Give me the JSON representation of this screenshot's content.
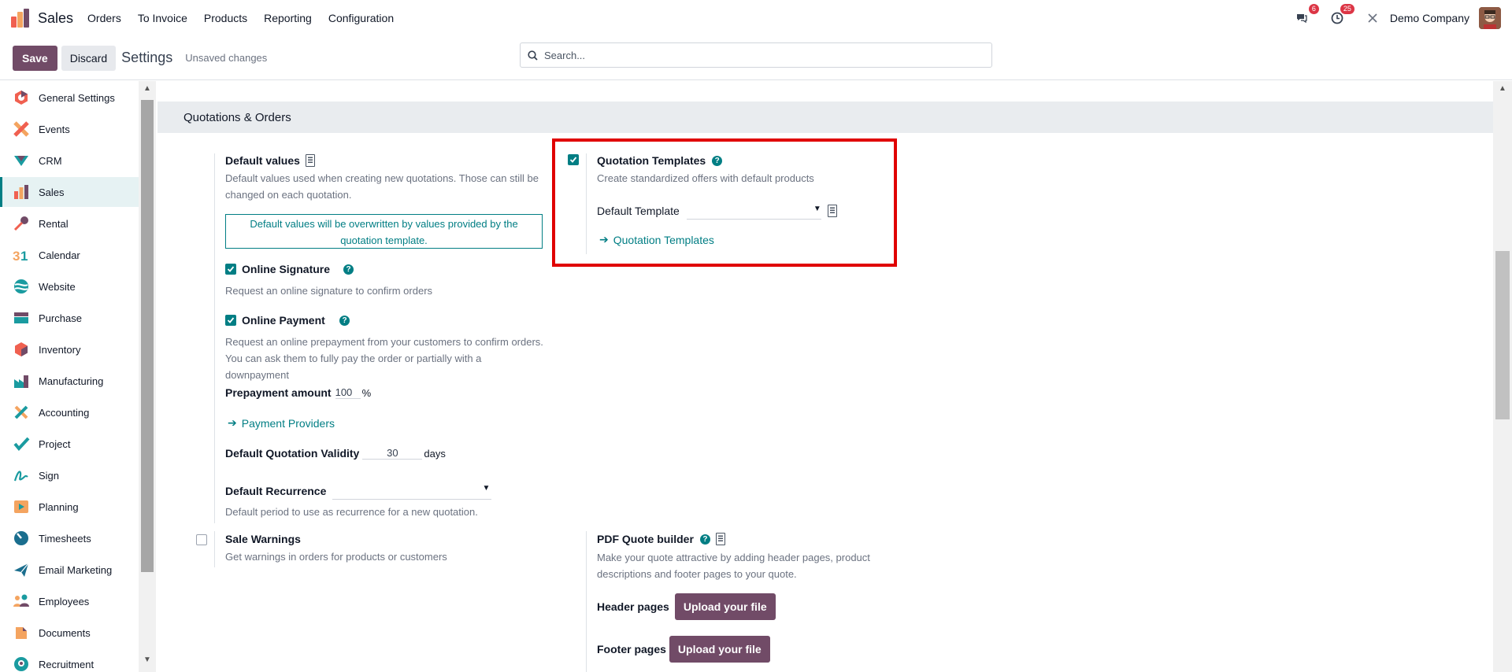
{
  "navbar": {
    "app_title": "Sales",
    "menu": [
      "Orders",
      "To Invoice",
      "Products",
      "Reporting",
      "Configuration"
    ],
    "messages_count": "6",
    "activities_count": "25",
    "company": "Demo Company"
  },
  "control": {
    "save_label": "Save",
    "discard_label": "Discard",
    "title": "Settings",
    "status": "Unsaved changes",
    "search_placeholder": "Search..."
  },
  "sidebar": {
    "items": [
      {
        "label": "General Settings",
        "icon": "general-settings-icon"
      },
      {
        "label": "Events",
        "icon": "events-icon"
      },
      {
        "label": "CRM",
        "icon": "crm-icon"
      },
      {
        "label": "Sales",
        "icon": "sales-icon",
        "active": true
      },
      {
        "label": "Rental",
        "icon": "rental-icon"
      },
      {
        "label": "Calendar",
        "icon": "calendar-icon"
      },
      {
        "label": "Website",
        "icon": "website-icon"
      },
      {
        "label": "Purchase",
        "icon": "purchase-icon"
      },
      {
        "label": "Inventory",
        "icon": "inventory-icon"
      },
      {
        "label": "Manufacturing",
        "icon": "manufacturing-icon"
      },
      {
        "label": "Accounting",
        "icon": "accounting-icon"
      },
      {
        "label": "Project",
        "icon": "project-icon"
      },
      {
        "label": "Sign",
        "icon": "sign-icon"
      },
      {
        "label": "Planning",
        "icon": "planning-icon"
      },
      {
        "label": "Timesheets",
        "icon": "timesheets-icon"
      },
      {
        "label": "Email Marketing",
        "icon": "email-marketing-icon"
      },
      {
        "label": "Employees",
        "icon": "employees-icon"
      },
      {
        "label": "Documents",
        "icon": "documents-icon"
      },
      {
        "label": "Recruitment",
        "icon": "recruitment-icon"
      }
    ]
  },
  "section": {
    "title": "Quotations & Orders"
  },
  "default_values": {
    "label": "Default values",
    "description": "Default values used when creating new quotations. Those can still be changed on each quotation.",
    "notice": "Default values will be overwritten by values provided by the quotation template."
  },
  "online_signature": {
    "label": "Online Signature",
    "checked": true,
    "description": "Request an online signature to confirm orders"
  },
  "online_payment": {
    "label": "Online Payment",
    "checked": true,
    "description": "Request an online prepayment from your customers to confirm orders. You can ask them to fully pay the order or partially with a downpayment",
    "prepayment_label": "Prepayment amount",
    "prepayment_value": "100",
    "prepayment_unit": "%",
    "link": "Payment Providers"
  },
  "validity": {
    "label": "Default Quotation Validity",
    "value": "30",
    "unit": "days"
  },
  "recurrence": {
    "label": "Default Recurrence",
    "value": "",
    "description": "Default period to use as recurrence for a new quotation."
  },
  "quotation_templates": {
    "label": "Quotation Templates",
    "checked": true,
    "description": "Create standardized offers with default products",
    "template_label": "Default Template",
    "template_value": "",
    "link": "Quotation Templates"
  },
  "sale_warnings": {
    "label": "Sale Warnings",
    "checked": false,
    "description": "Get warnings in orders for products or customers"
  },
  "pdf_builder": {
    "label": "PDF Quote builder",
    "description": "Make your quote attractive by adding header pages, product descriptions and footer pages to your quote.",
    "header_label": "Header pages",
    "footer_label": "Footer pages",
    "upload_label": "Upload your file"
  },
  "colors": {
    "brand": "#714b67",
    "accent": "#017e84",
    "highlight": "#e00000"
  }
}
